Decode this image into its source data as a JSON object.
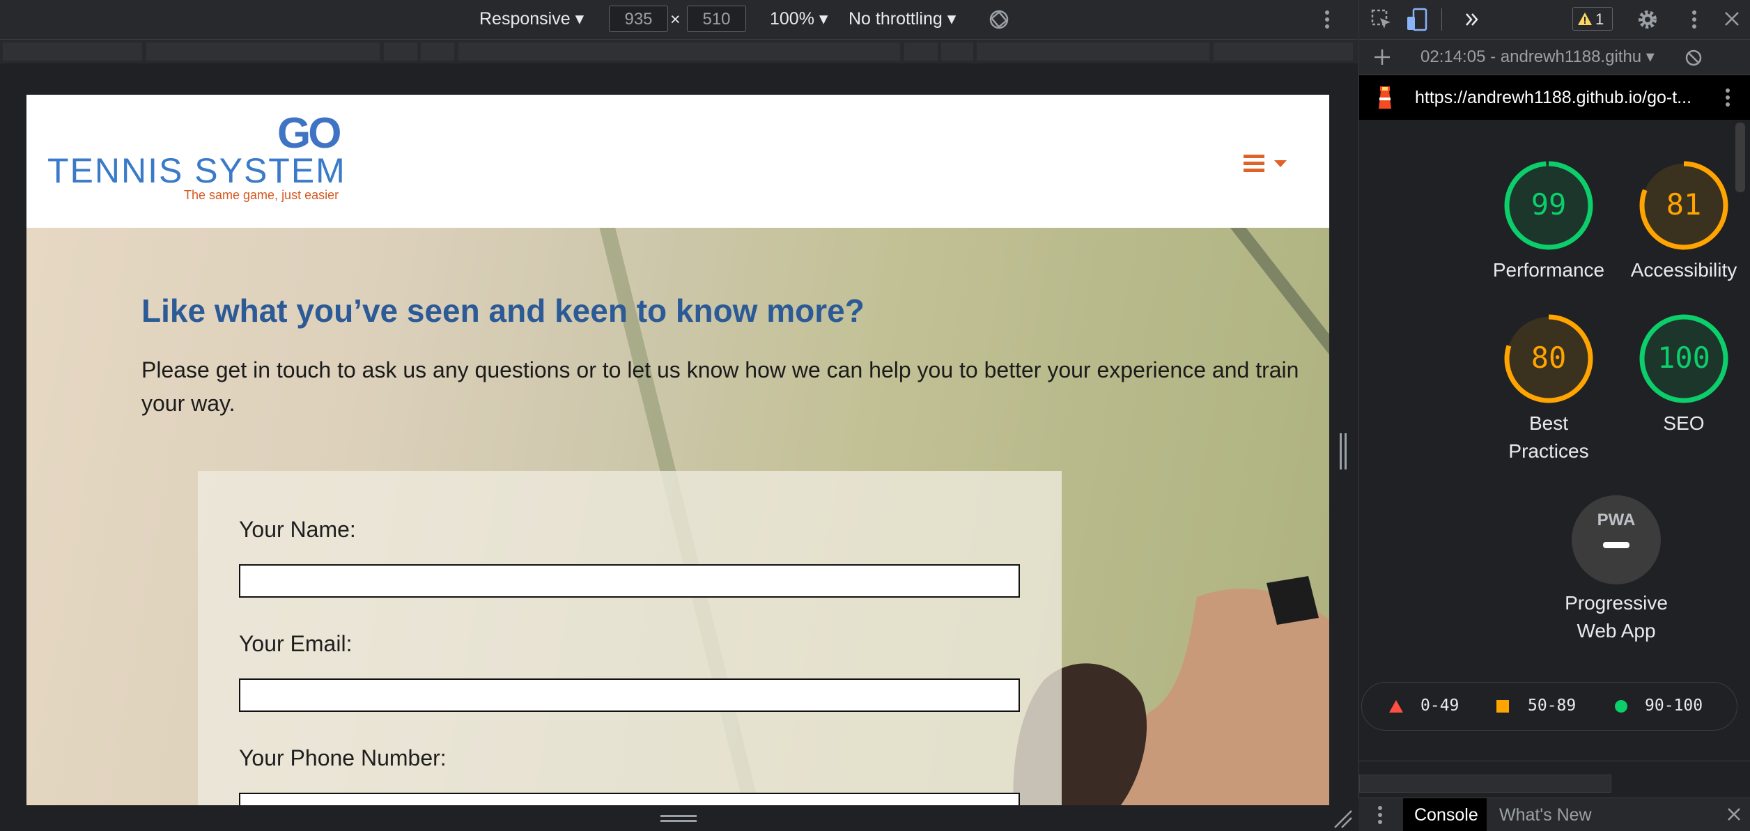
{
  "device_toolbar": {
    "device": "Responsive",
    "width": "935",
    "times": "×",
    "height": "510",
    "zoom": "100%",
    "throttling": "No throttling"
  },
  "site": {
    "logo": {
      "top": "GO",
      "main": "TENNIS SYSTEM",
      "tagline": "The same game, just easier"
    },
    "hero_title": "Like what you’ve seen and keen to know more?",
    "hero_text": "Please get in touch to ask us any questions or to let us know how we can help you to better your experience and train your way.",
    "form": {
      "name_label": "Your Name:",
      "email_label": "Your Email:",
      "phone_label": "Your Phone Number:"
    },
    "colors": {
      "brand_blue": "#2c5a97",
      "accent_orange": "#e0622a"
    }
  },
  "devtools": {
    "warning_count": "1",
    "report_selector": "02:14:05 - andrewh1188.githu",
    "url": "https://andrewh1188.github.io/go-t...",
    "scores": [
      {
        "value": "99",
        "label": "Performance",
        "color": "#0cce6b",
        "fraction": 0.99
      },
      {
        "value": "81",
        "label": "Accessibility",
        "color": "#ffa400",
        "fraction": 0.81
      },
      {
        "value": "80",
        "label_line1": "Best",
        "label_line2": "Practices",
        "color": "#ffa400",
        "fraction": 0.8
      },
      {
        "value": "100",
        "label": "SEO",
        "color": "#0cce6b",
        "fraction": 1.0
      }
    ],
    "pwa": {
      "badge": "PWA",
      "label_line1": "Progressive",
      "label_line2": "Web App"
    },
    "legend": [
      {
        "range": "0-49",
        "color": "#ff4e42"
      },
      {
        "range": "50-89",
        "color": "#ffa400"
      },
      {
        "range": "90-100",
        "color": "#0cce6b"
      }
    ],
    "drawer_tabs": {
      "console": "Console",
      "whats_new": "What's New"
    }
  }
}
